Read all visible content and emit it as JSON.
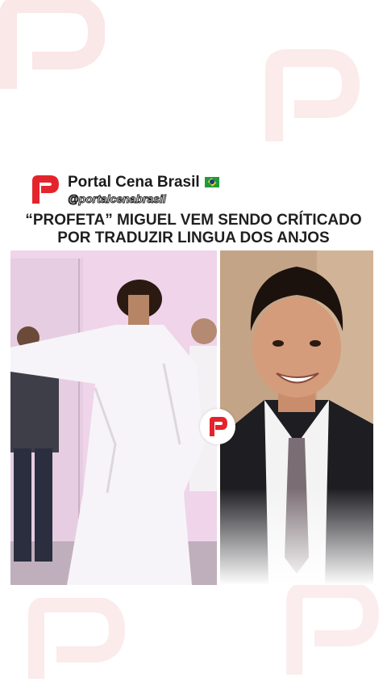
{
  "post": {
    "brand_name": "Portal Cena Brasil",
    "handle": "@portalcenabrasil",
    "headline_line1": "“PROFETA” MIGUEL VEM SENDO CRÍTICADO",
    "headline_line2": "POR TRADUZIR LINGUA DOS ANJOS"
  },
  "colors": {
    "brand_red": "#e4242c",
    "watermark": "#f9d7d7"
  },
  "icons": {
    "logo": "portal-p-logo-icon",
    "flag": "brazil-flag-icon",
    "badge": "portal-p-badge-icon"
  }
}
